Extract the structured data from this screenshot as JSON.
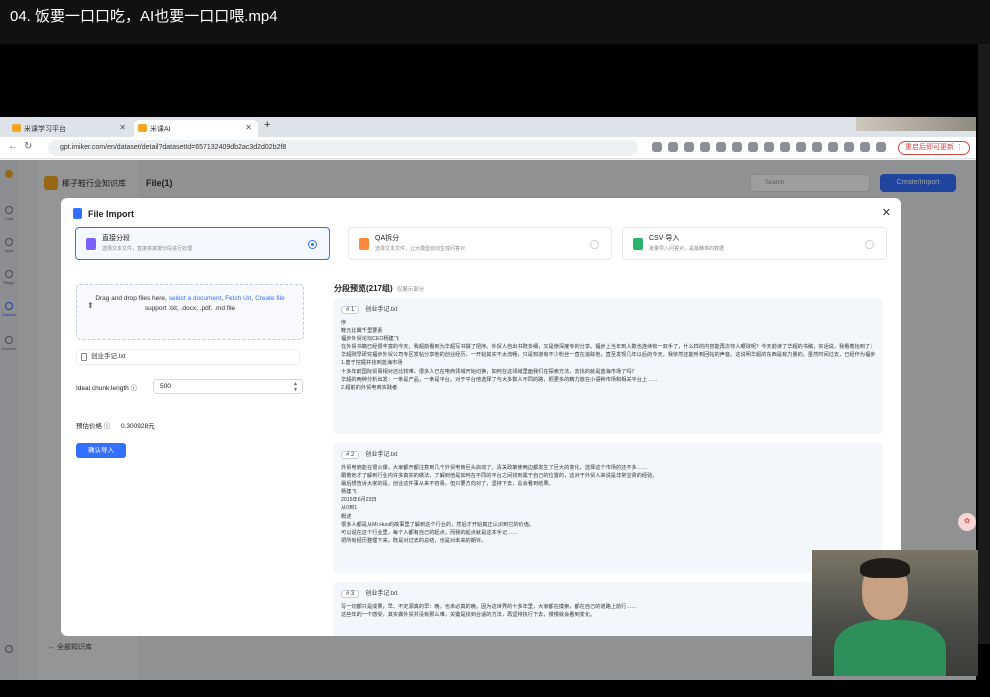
{
  "player": {
    "title": "04. 饭要一口口吃，AI也要一口口喂.mp4"
  },
  "browser": {
    "tabs": [
      {
        "label": "米课学习平台"
      },
      {
        "label": "米课AI"
      }
    ],
    "url": "gpt.imiker.com/en/dataset/detail?datasetId=657132409db2ac3d2d02b2f8",
    "update_label": "重启后即可更新 ⋮"
  },
  "app": {
    "kb_name": "椰子鞋行业知识库",
    "header_title": "File(1)",
    "search_placeholder": "Search",
    "create_label": "Create/Import",
    "all_kb_label": "全部知识库",
    "rail": [
      "Chat",
      "Apps",
      "Plugin",
      "Dataset",
      "Account"
    ]
  },
  "modal": {
    "title": "File Import",
    "modes": [
      {
        "title": "直接分段",
        "desc": "选择文本文件，直接将其按分段进行处理",
        "color": "#7b61ff"
      },
      {
        "title": "QA拆分",
        "desc": "选择文本文件，让大模型自动生成问答对",
        "color": "#ff8a3d"
      },
      {
        "title": "CSV 导入",
        "desc": "批量导入问答对，是最精准的数据",
        "color": "#2fb36b"
      }
    ],
    "drop": {
      "line1_prefix": "Drag and drop files here, ",
      "link1": "select a document",
      "sep": ", ",
      "link2": "Fetch Url",
      "link3": "Create file",
      "support": "support .txt, .docx, .pdf, .md file"
    },
    "file_name": "创业手记.txt",
    "chunk_label": "Ideal chunk length ⓘ",
    "chunk_value": "500",
    "price_label": "预估价格 ⓘ",
    "price_value": "0.300928元",
    "confirm_label": "确认导入",
    "preview": {
      "title": "分段预览(217组)",
      "subtitle": "仅展示部分",
      "chunks": [
        {
          "no": "# 1",
          "file": "创业手记.txt",
          "lines": [
            "序",
            "鞋元比翼千里要素",
            "福步外贸论坛CEO杨建飞",
            "在外贸书籍已经很丰富的今天，我超前看到为华超写书撰了把序。外贸人自出书既多细，又是使深度专的分享。福步上当年到人数也连续有一双手了，什么样的内容能再次夺人眼球呢？今天前读了华超的书稿，实话说，我看着抬到了：书中华超讲述了自己的创业经历，和大家分享了他如何华贸人生，值得外贸人一读。",
            "华超刚早研究福步外贸公司专区发帖分享他的创业经历，一开始其实不太流畅，只是知道有不少粉丝一直在追踪他，直至发现几年以后的今天，我依然还能听到回帖的声音。这说明华超的东西是有力量的。虽然时间过去，已经作为福步多年的作家和版主的华超，他依然在分享他的学习下去的……",
            "1.善于挖掘并找到蓝海市场",
            "十多年前国际贸易相对还比较难，很多人已在电商领域开始切换，如何在这领域里面我们在探索方法，去找的就是蓝海市场了吗？",
            "华超的两种分析出发：一条是产品，一条是平台。对于平台他选择了与大多数人不同的路，把更多的精力放在小语种市场和相关平台上……",
            "2.超前的外贸电商实践者"
          ]
        },
        {
          "no": "# 2",
          "file": "创业手记.txt",
          "lines": [
            "外贸电商能在很火爆，大家都开都注意到几个外贸电商巨头启动了，清关政策使两边都发生了巨大的变化，选择这个市场的还不多……",
            "跟着他才了解到行业内许多真实的做法，了解到他是如何在不同的平台之间找到属于自己的位置的，这对于外贸人来说是非常宝贵的经验。",
            "最后想告诉大家的是，创业这件事从来不容易，但只要方向对了，坚持下去，总会看到结果。",
            "杨建飞",
            "2015年6月23日",
            "从0到1",
            "概述",
            "很多人都是从Mr.Huo的故事里了解到这个行业的，然后才开始真正认识到它的价值。",
            "可以说在这个行业里，每个人都有自己的起点，而我的起点就是这本手记……",
            "把所有经历整理下来，既是对过去的总结，也是对未来的期许。"
          ]
        },
        {
          "no": "# 3",
          "file": "创业手记.txt",
          "lines": [
            "写一切都只是成果，早、不定源真的早：晚，也未必真的晚。因为这世界的十多年里，大家都在摸索，都在自己的道路上前行……",
            "这些年的一个感受，其实做外贸并没有那么难，关键是找到合适的方法，再坚持执行下去，慢慢就会看到变化。"
          ]
        }
      ]
    }
  }
}
